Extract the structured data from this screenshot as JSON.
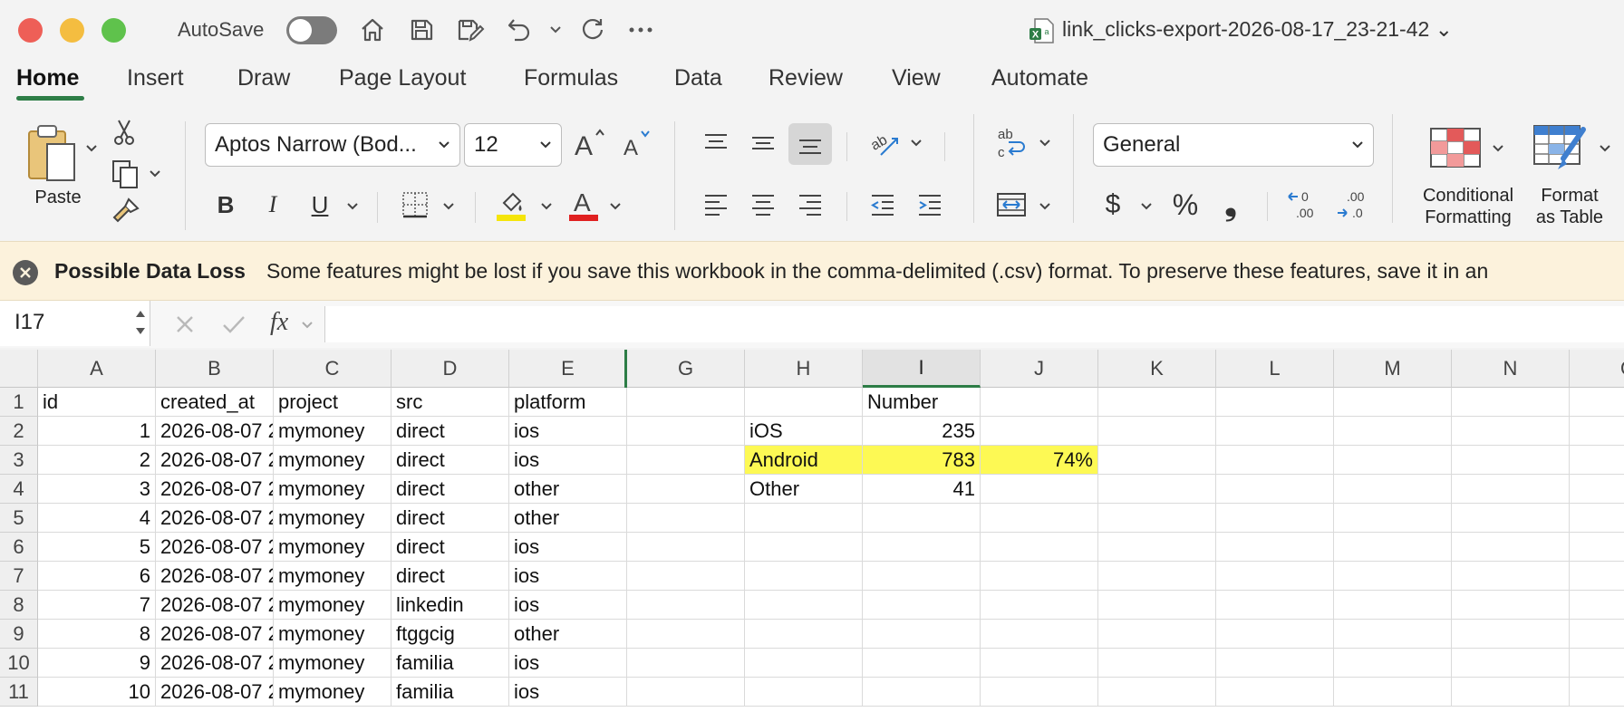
{
  "titlebar": {
    "autosave_label": "AutoSave",
    "document_title": "link_clicks-export-2026-08-17_23-21-42",
    "title_chevron": "⌄"
  },
  "tabs": [
    "Home",
    "Insert",
    "Draw",
    "Page Layout",
    "Formulas",
    "Data",
    "Review",
    "View",
    "Automate"
  ],
  "ribbon": {
    "paste_label": "Paste",
    "font_name": "Aptos Narrow (Bod...",
    "font_size": "12",
    "number_format": "General",
    "conditional_formatting_label_1": "Conditional",
    "conditional_formatting_label_2": "Formatting",
    "format_table_label_1": "Format",
    "format_table_label_2": "as Table",
    "bold": "B",
    "italic": "I",
    "underline": "U",
    "currency": "$",
    "percent": "%",
    "comma": "❟",
    "colors": {
      "highlight": "#f5e50a",
      "font_color": "#e02020",
      "accent": "#2d7d46"
    }
  },
  "infobar": {
    "title": "Possible Data Loss",
    "message": "Some features might be lost if you save this workbook in the comma-delimited (.csv) format. To preserve these features, save it in an"
  },
  "formula_bar": {
    "name_box": "I17",
    "fx": "fx",
    "formula": ""
  },
  "sheet": {
    "columns": [
      "A",
      "B",
      "C",
      "D",
      "E",
      "G",
      "H",
      "I",
      "J",
      "K",
      "L",
      "M",
      "N",
      "O"
    ],
    "selected_column": "I",
    "rows": [
      {
        "n": "1",
        "A": "id",
        "B": "created_at",
        "C": "project",
        "D": "src",
        "E": "platform",
        "H": "",
        "I": "Number",
        "J": ""
      },
      {
        "n": "2",
        "A": "1",
        "B": "2026-08-07 2",
        "C": "mymoney",
        "D": "direct",
        "E": "ios",
        "H": "iOS",
        "I": "235",
        "J": ""
      },
      {
        "n": "3",
        "A": "2",
        "B": "2026-08-07 2",
        "C": "mymoney",
        "D": "direct",
        "E": "ios",
        "H": "Android",
        "I": "783",
        "J": "74%"
      },
      {
        "n": "4",
        "A": "3",
        "B": "2026-08-07 2",
        "C": "mymoney",
        "D": "direct",
        "E": "other",
        "H": "Other",
        "I": "41",
        "J": ""
      },
      {
        "n": "5",
        "A": "4",
        "B": "2026-08-07 2",
        "C": "mymoney",
        "D": "direct",
        "E": "other",
        "H": "",
        "I": "",
        "J": ""
      },
      {
        "n": "6",
        "A": "5",
        "B": "2026-08-07 2",
        "C": "mymoney",
        "D": "direct",
        "E": "ios",
        "H": "",
        "I": "",
        "J": ""
      },
      {
        "n": "7",
        "A": "6",
        "B": "2026-08-07 2",
        "C": "mymoney",
        "D": "direct",
        "E": "ios",
        "H": "",
        "I": "",
        "J": ""
      },
      {
        "n": "8",
        "A": "7",
        "B": "2026-08-07 2",
        "C": "mymoney",
        "D": "linkedin",
        "E": "ios",
        "H": "",
        "I": "",
        "J": ""
      },
      {
        "n": "9",
        "A": "8",
        "B": "2026-08-07 2",
        "C": "mymoney",
        "D": "ftggcig",
        "E": "other",
        "H": "",
        "I": "",
        "J": ""
      },
      {
        "n": "10",
        "A": "9",
        "B": "2026-08-07 2",
        "C": "mymoney",
        "D": "familia",
        "E": "ios",
        "H": "",
        "I": "",
        "J": ""
      },
      {
        "n": "11",
        "A": "10",
        "B": "2026-08-07 2",
        "C": "mymoney",
        "D": "familia",
        "E": "ios",
        "H": "",
        "I": "",
        "J": ""
      }
    ],
    "highlight_color": "#fdf954"
  }
}
